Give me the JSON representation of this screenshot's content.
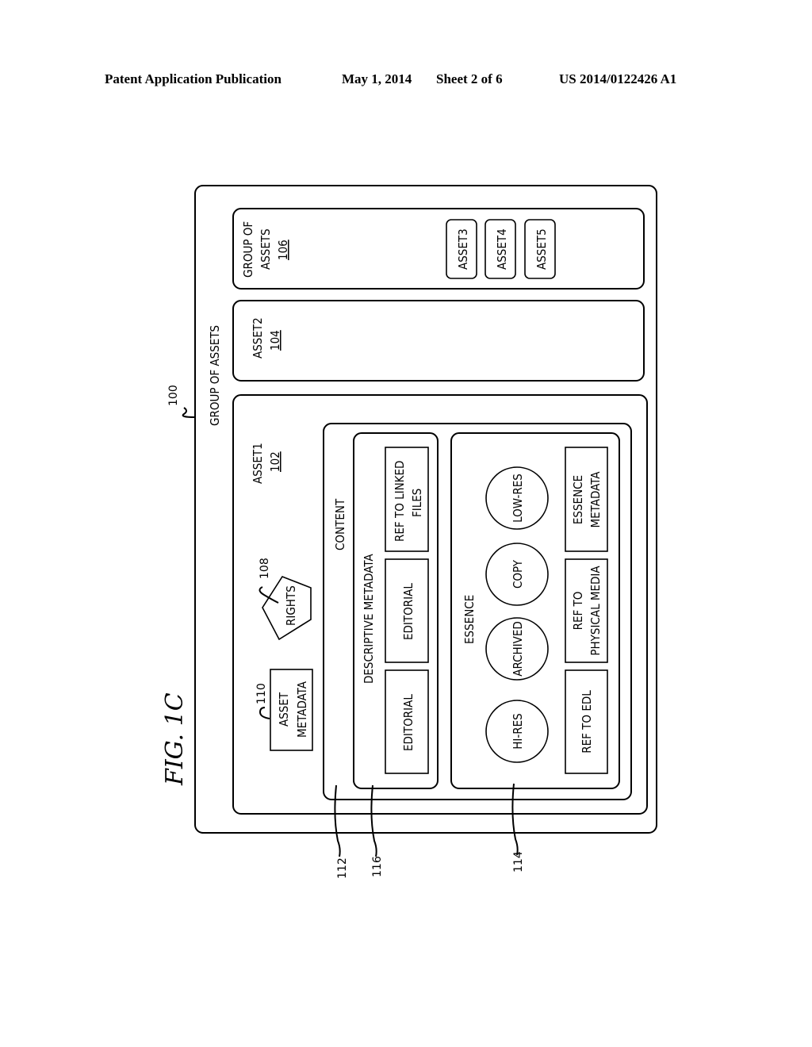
{
  "header": {
    "publication": "Patent Application Publication",
    "date": "May 1, 2014",
    "sheet": "Sheet 2 of 6",
    "number": "US 2014/0122426 A1"
  },
  "figure": {
    "label": "FIG. 1C",
    "group_of_assets": {
      "title": "GROUP OF ASSETS",
      "ref": "100"
    },
    "asset1": {
      "title": "ASSET1",
      "ref": "102"
    },
    "asset2": {
      "title": "ASSET2",
      "ref": "104"
    },
    "group_106": {
      "title_line1": "GROUP OF",
      "title_line2": "ASSETS",
      "ref": "106",
      "items": [
        "ASSET3",
        "ASSET4",
        "ASSET5"
      ]
    },
    "rights": {
      "label": "RIGHTS",
      "ref": "108"
    },
    "asset_metadata": {
      "line1": "ASSET",
      "line2": "METADATA",
      "ref": "110"
    },
    "content": {
      "title": "CONTENT",
      "ref": "112"
    },
    "descriptive_metadata": {
      "title": "DESCRIPTIVE METADATA",
      "ref": "116",
      "boxes": [
        {
          "line1": "EDITORIAL",
          "line2": ""
        },
        {
          "line1": "EDITORIAL",
          "line2": ""
        },
        {
          "line1": "REF TO LINKED",
          "line2": "FILES"
        }
      ]
    },
    "essence": {
      "title": "ESSENCE",
      "ref": "114",
      "circles": [
        "HI-RES",
        "ARCHIVED",
        "COPY",
        "LOW-RES"
      ],
      "boxes": [
        {
          "line1": "REF TO EDL",
          "line2": ""
        },
        {
          "line1": "REF TO",
          "line2": "PHYSICAL MEDIA"
        },
        {
          "line1": "ESSENCE",
          "line2": "METADATA"
        }
      ]
    }
  }
}
